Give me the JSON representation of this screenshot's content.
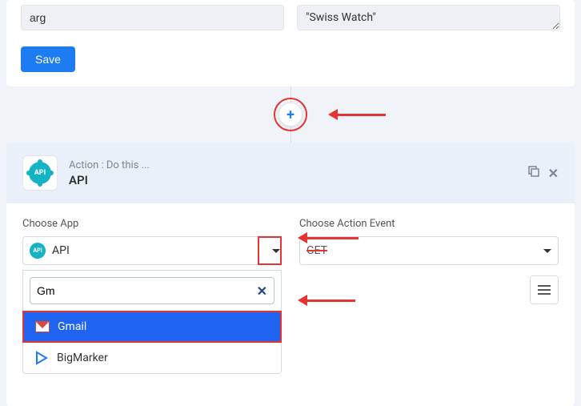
{
  "form": {
    "field1_value": "arg",
    "field2_value": "\"Swiss Watch\"",
    "save_label": "Save"
  },
  "action_block": {
    "label": "Action : Do this ...",
    "name": "API"
  },
  "choose_app": {
    "label": "Choose App",
    "selected": "API",
    "search_value": "Gm",
    "options": [
      {
        "label": "Gmail",
        "icon": "gmail",
        "selected": true
      },
      {
        "label": "BigMarker",
        "icon": "bigmarker",
        "selected": false
      }
    ]
  },
  "choose_event": {
    "label": "Choose Action Event",
    "selected": "GET"
  },
  "icons": {
    "api": "API"
  }
}
